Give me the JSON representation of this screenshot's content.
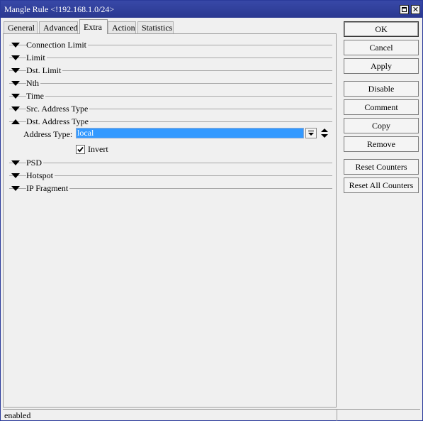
{
  "window": {
    "title": "Mangle Rule <!192.168.1.0/24>"
  },
  "tabs": [
    {
      "label": "General"
    },
    {
      "label": "Advanced"
    },
    {
      "label": "Extra"
    },
    {
      "label": "Action"
    },
    {
      "label": "Statistics"
    }
  ],
  "active_tab": "Extra",
  "sections": [
    {
      "label": "Connection Limit",
      "expanded": false
    },
    {
      "label": "Limit",
      "expanded": false
    },
    {
      "label": "Dst. Limit",
      "expanded": false
    },
    {
      "label": "Nth",
      "expanded": false
    },
    {
      "label": "Time",
      "expanded": false
    },
    {
      "label": "Src. Address Type",
      "expanded": false
    },
    {
      "label": "Dst. Address Type",
      "expanded": true
    },
    {
      "label": "PSD",
      "expanded": false
    },
    {
      "label": "Hotspot",
      "expanded": false
    },
    {
      "label": "IP Fragment",
      "expanded": false
    }
  ],
  "dst_address_type": {
    "field_label": "Address Type:",
    "value": "local",
    "invert_label": "Invert",
    "invert_checked": true
  },
  "buttons": [
    {
      "label": "OK"
    },
    {
      "label": "Cancel"
    },
    {
      "label": "Apply"
    },
    {
      "label": "Disable"
    },
    {
      "label": "Comment"
    },
    {
      "label": "Copy"
    },
    {
      "label": "Remove"
    },
    {
      "label": "Reset Counters"
    },
    {
      "label": "Reset All Counters"
    }
  ],
  "status": {
    "text": "enabled"
  },
  "icons": {
    "maximize": "maximize-icon",
    "close": "close-icon",
    "collapsed": "triangle-down-icon",
    "expanded": "triangle-up-icon",
    "dropdown": "dropdown-arrow-icon",
    "updown": "up-down-arrows-icon",
    "check": "checkmark-icon"
  },
  "colors": {
    "titlebar": "#2a3890",
    "selection": "#3399ff"
  }
}
